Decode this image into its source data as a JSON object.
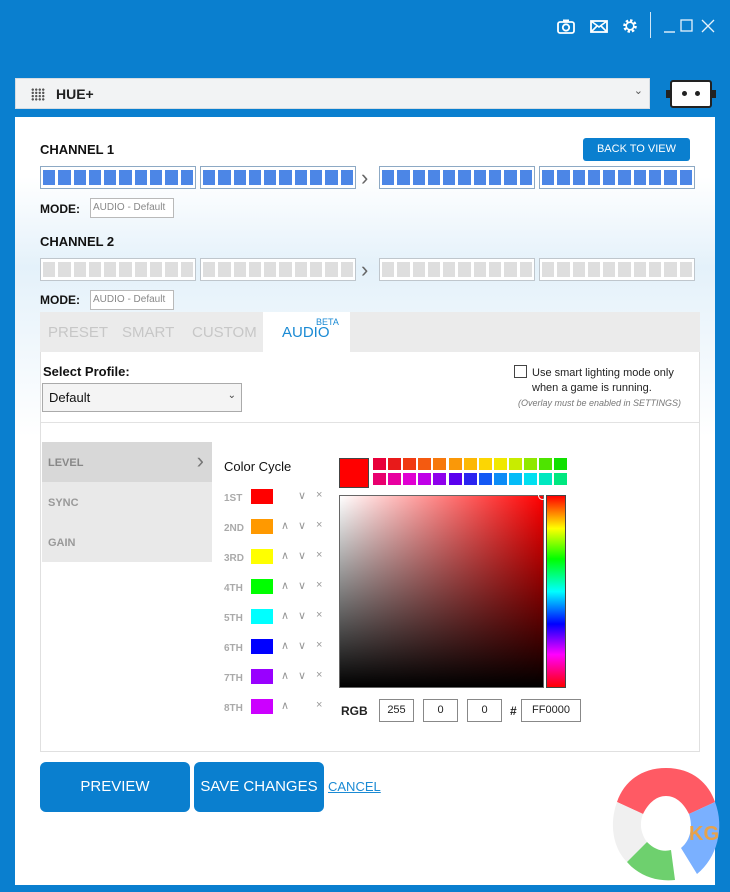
{
  "window": {
    "icons": [
      "camera-icon",
      "mail-icon",
      "gear-icon",
      "minimize-icon",
      "maximize-icon",
      "close-icon"
    ]
  },
  "device": {
    "name": "HUE+"
  },
  "back_button": "BACK TO VIEW",
  "channels": [
    {
      "title": "CHANNEL 1",
      "mode_label": "MODE:",
      "mode_value": "AUDIO - Default",
      "state": "on"
    },
    {
      "title": "CHANNEL 2",
      "mode_label": "MODE:",
      "mode_value": "AUDIO - Default",
      "state": "off"
    }
  ],
  "tabs": {
    "preset": "PRESET",
    "smart": "SMART",
    "custom": "CUSTOM",
    "audio": "AUDIO",
    "beta": "BETA"
  },
  "profile": {
    "label": "Select Profile:",
    "value": "Default"
  },
  "smart_mode": {
    "text": "Use smart lighting mode only when a game is running.",
    "note": "(Overlay must be enabled in SETTINGS)",
    "checked": false
  },
  "menu": [
    "LEVEL",
    "SYNC",
    "GAIN"
  ],
  "color_cycle": {
    "title": "Color Cycle",
    "rows": [
      {
        "label": "1ST",
        "color": "#ff0000"
      },
      {
        "label": "2ND",
        "color": "#ff9900"
      },
      {
        "label": "3RD",
        "color": "#ffff00"
      },
      {
        "label": "4TH",
        "color": "#00ff00"
      },
      {
        "label": "5TH",
        "color": "#00ffff"
      },
      {
        "label": "6TH",
        "color": "#0000ff"
      },
      {
        "label": "7TH",
        "color": "#9900ff"
      },
      {
        "label": "8TH",
        "color": "#cc00ff"
      }
    ]
  },
  "palette": {
    "row1": [
      "#e8003a",
      "#e81a1a",
      "#f03a12",
      "#f45a10",
      "#f7780c",
      "#fa9808",
      "#fcb805",
      "#fcd603",
      "#f0e800",
      "#c8ec00",
      "#8fe800",
      "#4ee400",
      "#10e000"
    ],
    "row2": [
      "#e8006e",
      "#e800a0",
      "#e000d2",
      "#c000e8",
      "#8e00ec",
      "#5a00ee",
      "#2a24f0",
      "#1458f4",
      "#0c8cf6",
      "#04bcf8",
      "#00e0f0",
      "#00e8c0",
      "#00e880"
    ]
  },
  "picker": {
    "selected": "#ff0000"
  },
  "rgb": {
    "label": "RGB",
    "r": "255",
    "g": "0",
    "b": "0",
    "hash": "#",
    "hex": "FF0000"
  },
  "actions": {
    "preview": "PREVIEW",
    "save": "SAVE CHANGES",
    "cancel": "CANCEL"
  },
  "watermark": {
    "text": "KG"
  }
}
